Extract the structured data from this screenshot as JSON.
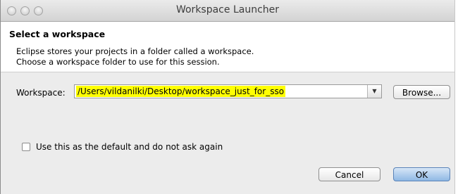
{
  "window": {
    "title": "Workspace Launcher"
  },
  "header": {
    "title": "Select a workspace",
    "description_line1": "Eclipse stores your projects in a folder called a workspace.",
    "description_line2": "Choose a workspace folder to use for this session."
  },
  "workspace": {
    "label": "Workspace:",
    "value": "/Users/vildanilki/Desktop/workspace_just_for_sso",
    "dropdown_icon": "triangle-down",
    "browse_label": "Browse..."
  },
  "options": {
    "default_checkbox_label": "Use this as the default and do not ask again",
    "default_checked": false
  },
  "actions": {
    "cancel_label": "Cancel",
    "ok_label": "OK"
  },
  "colors": {
    "highlight": "#ffff00",
    "ok_button": "#8fb8e4"
  }
}
